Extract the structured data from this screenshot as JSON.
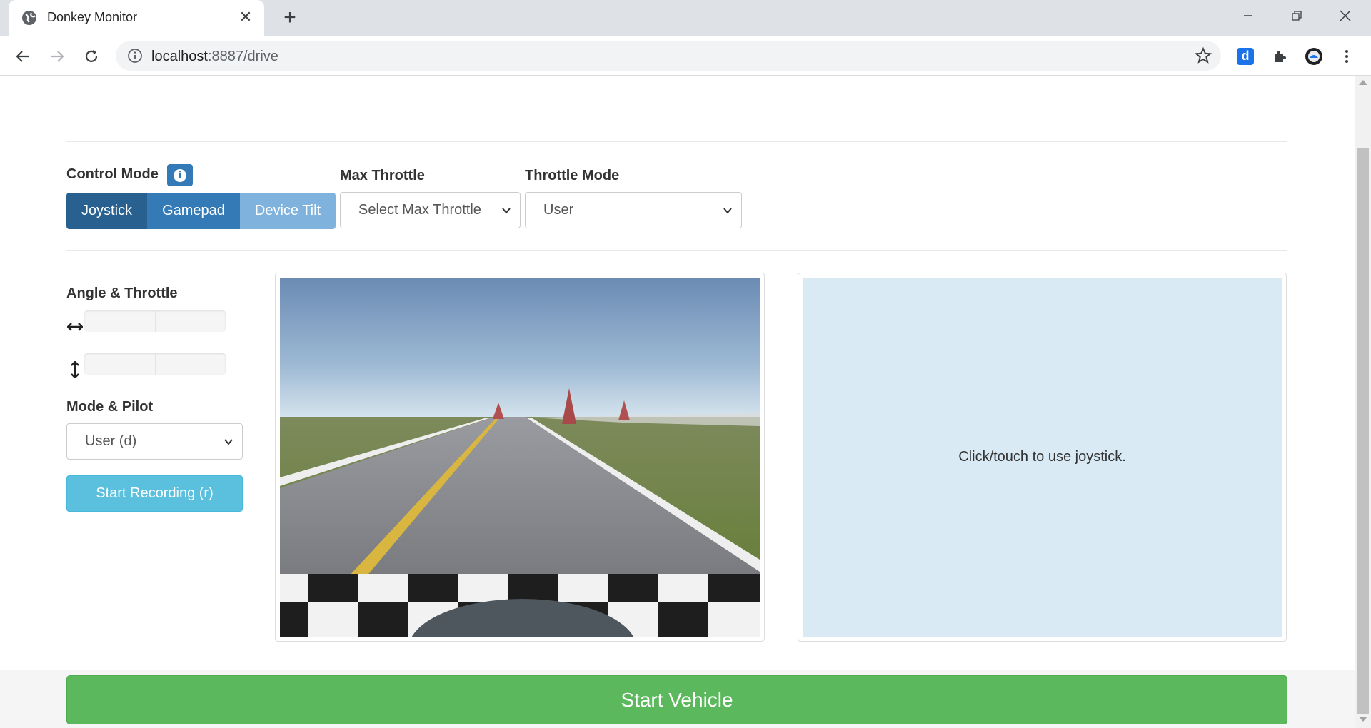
{
  "browser": {
    "tab_title": "Donkey Monitor",
    "url_host": "localhost",
    "url_rest": ":8887/drive"
  },
  "controls": {
    "control_mode_label": "Control Mode",
    "modes": [
      "Joystick",
      "Gamepad",
      "Device Tilt"
    ],
    "active_mode": "Joystick",
    "max_throttle_label": "Max Throttle",
    "max_throttle_value": "Select Max Throttle",
    "throttle_mode_label": "Throttle Mode",
    "throttle_mode_value": "User"
  },
  "status": {
    "angle_throttle_label": "Angle & Throttle",
    "angle_value": 0,
    "throttle_value": 0,
    "mode_pilot_label": "Mode & Pilot",
    "mode_pilot_value": "User (d)",
    "record_button": "Start Recording (r)"
  },
  "joystick_hint": "Click/touch to use joystick.",
  "start_vehicle_button": "Start Vehicle",
  "colors": {
    "primary": "#337ab7",
    "primary_active": "#286090",
    "info": "#5bc0de",
    "success": "#5cb85c",
    "joystick_bg": "#d9eaf5"
  }
}
